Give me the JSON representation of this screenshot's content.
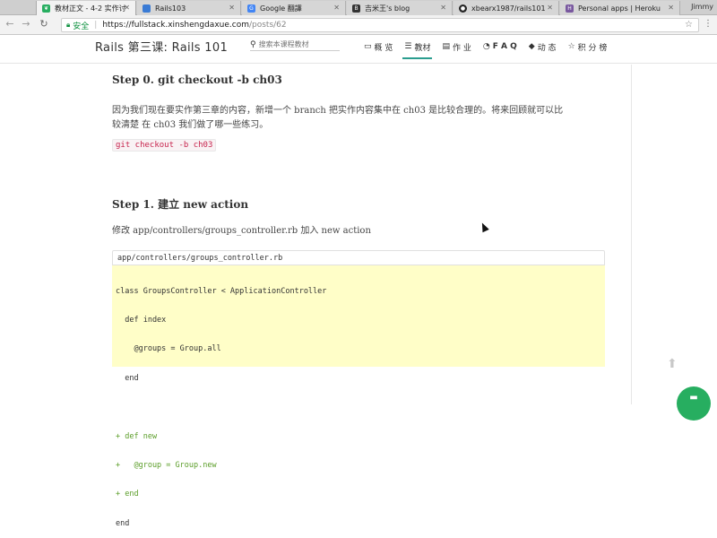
{
  "browser": {
    "user": "Jimmy",
    "tabs": [
      {
        "title": "教材正文 - 4-2 实作讨",
        "active": true,
        "fav_color": "#27ae60"
      },
      {
        "title": "Rails103",
        "active": false,
        "fav_color": "#3a7bd5"
      },
      {
        "title": "Google 翻譯",
        "active": false,
        "fav_color": "#4285f4"
      },
      {
        "title": "吉米王's blog",
        "active": false,
        "fav_color": "#333333"
      },
      {
        "title": "xbearx1987/rails101",
        "active": false,
        "fav_color": "#222222"
      },
      {
        "title": "Personal apps | Heroku",
        "active": false,
        "fav_color": "#79589f"
      }
    ],
    "secure_label": "安全",
    "url_host": "https://fullstack.xinshengdaxue.com",
    "url_path": "/posts/62"
  },
  "header": {
    "site_title": "Rails 第三课: Rails 101",
    "search_placeholder": "搜索本课程教材",
    "nav": [
      {
        "label": "概 览",
        "icon": "monitor-icon",
        "glyph": "▭",
        "active": false
      },
      {
        "label": "教材",
        "icon": "list-icon",
        "glyph": "☰",
        "active": true
      },
      {
        "label": "作 业",
        "icon": "document-icon",
        "glyph": "▤",
        "active": false
      },
      {
        "label": "F A Q",
        "icon": "comments-icon",
        "glyph": "◔",
        "active": false
      },
      {
        "label": "动 态",
        "icon": "tags-icon",
        "glyph": "◆",
        "active": false
      },
      {
        "label": "积 分 榜",
        "icon": "star-icon",
        "glyph": "☆",
        "active": false
      }
    ]
  },
  "content": {
    "step0_title": "Step 0. git checkout -b ch03",
    "step0_para_line1": "因为我们现在要实作第三章的内容，新增一个 branch 把实作内容集中在 ch03 是比较合理的。将来回顾就可以比",
    "step0_para_line2": "较清楚 在 ch03 我们做了哪一些练习。",
    "step0_code": "git checkout -b ch03",
    "step1_title": "Step 1. 建立 new action",
    "step1_para": "修改 app/controllers/groups_controller.rb 加入 new action",
    "code_filename": "app/controllers/groups_controller.rb",
    "code_lines": [
      {
        "text": "class GroupsController < ApplicationController",
        "added": false
      },
      {
        "text": "  def index",
        "added": false
      },
      {
        "text": "    @groups = Group.all",
        "added": false
      },
      {
        "text": "  end",
        "added": false
      },
      {
        "text": "",
        "added": false
      },
      {
        "text": "+ def new",
        "added": true
      },
      {
        "text": "+   @group = Group.new",
        "added": true
      },
      {
        "text": "+ end",
        "added": true
      },
      {
        "text": "end",
        "added": false
      }
    ]
  }
}
